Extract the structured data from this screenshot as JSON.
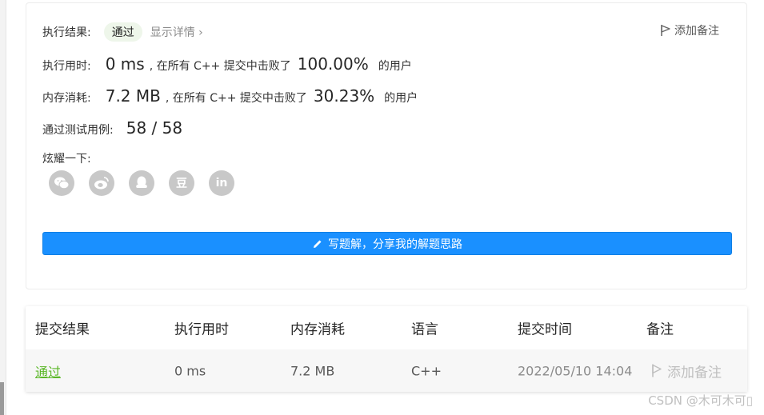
{
  "result": {
    "label": "执行结果:",
    "status": "通过",
    "detail_link": "显示详情 ›",
    "add_note": "添加备注"
  },
  "runtime": {
    "label": "执行用时:",
    "value": "0 ms",
    "prefix": ", 在所有 C++ 提交中击败了",
    "percent": "100.00%",
    "suffix": "的用户"
  },
  "memory": {
    "label": "内存消耗:",
    "value": "7.2 MB",
    "prefix": ", 在所有 C++ 提交中击败了",
    "percent": "30.23%",
    "suffix": "的用户"
  },
  "tests": {
    "label": "通过测试用例:",
    "value": "58 / 58"
  },
  "share": {
    "label": "炫耀一下:",
    "icons": [
      "wechat-icon",
      "weibo-icon",
      "qq-icon",
      "douban-icon",
      "linkedin-icon"
    ],
    "douban_glyph": "豆",
    "linkedin_glyph": "in"
  },
  "write_button": "写题解，分享我的解题思路",
  "table": {
    "headers": [
      "提交结果",
      "执行用时",
      "内存消耗",
      "语言",
      "提交时间",
      "备注"
    ],
    "rows": [
      {
        "result": "通过",
        "runtime": "0 ms",
        "memory": "7.2 MB",
        "language": "C++",
        "time": "2022/05/10 14:04",
        "note": "添加备注"
      }
    ]
  },
  "watermark": "CSDN @木可木可▯",
  "colors": {
    "accent": "#1a90ff",
    "pass_green": "#5ab726",
    "badge_bg": "#eef6ea"
  }
}
